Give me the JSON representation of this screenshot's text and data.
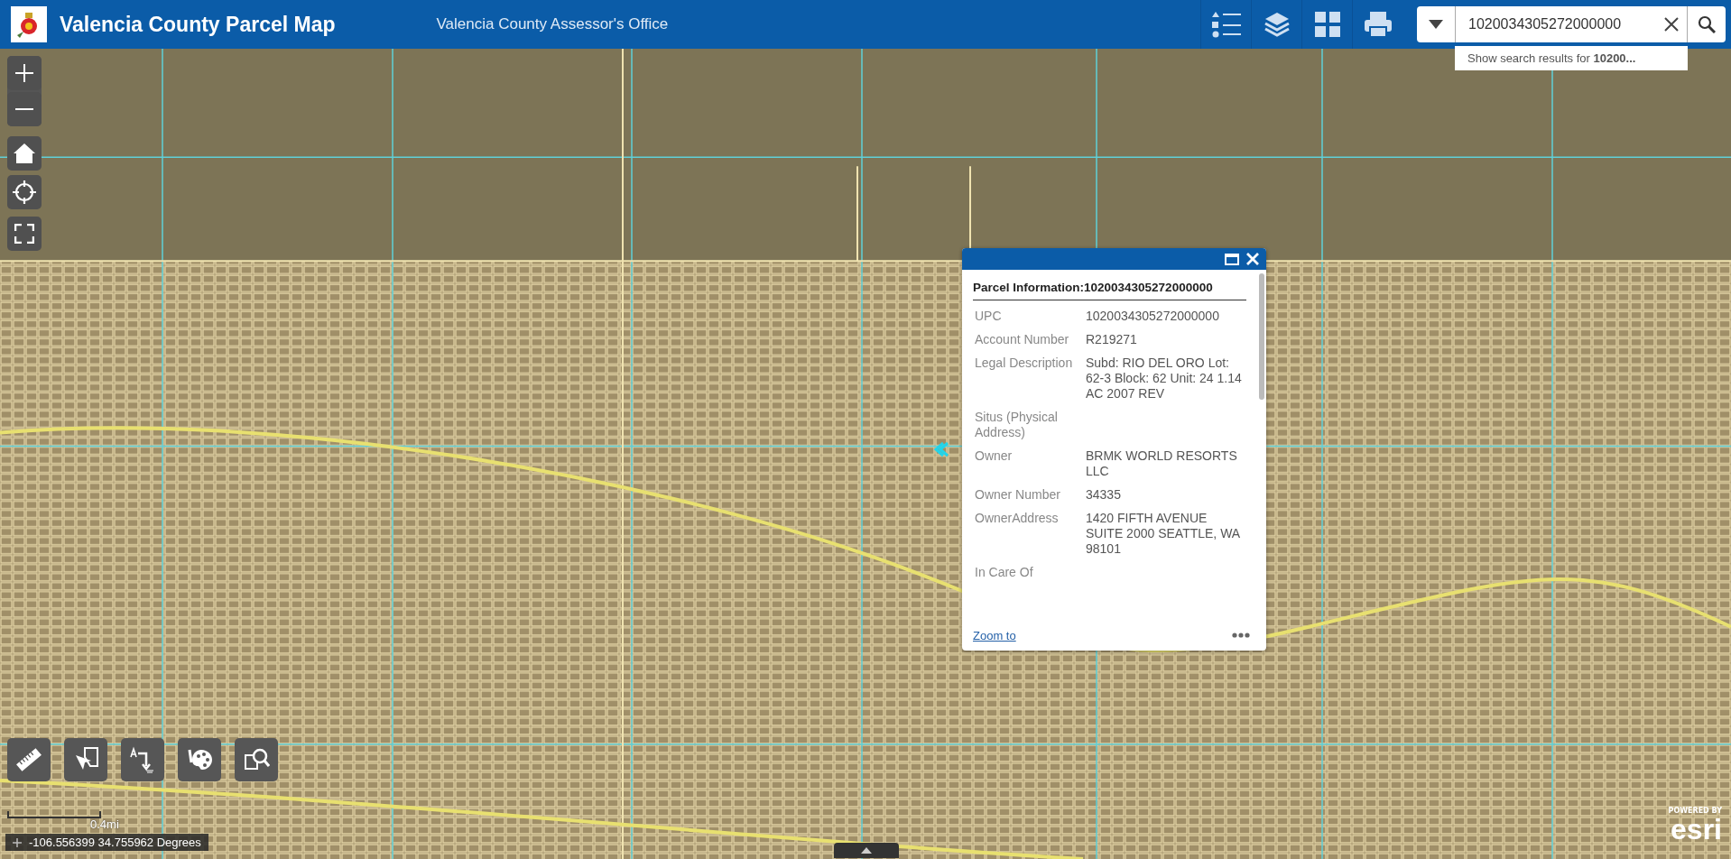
{
  "header": {
    "title": "Valencia County Parcel Map",
    "subtitle": "Valencia County Assessor's Office"
  },
  "search": {
    "value": "1020034305272000000",
    "suggestion": "Show search results for **10200...**"
  },
  "popup": {
    "title": "Parcel Information:1020034305272000000",
    "fields": [
      {
        "label": "UPC",
        "value": "1020034305272000000"
      },
      {
        "label": "Account Number",
        "value": "R219271"
      },
      {
        "label": "Legal Description",
        "value": "Subd: RIO DEL ORO Lot: 62-3 Block: 62 Unit: 24 1.14 AC 2007 REV"
      },
      {
        "label": "Situs (Physical Address)"
      },
      {
        "label": "Owner",
        "value": "BRMK WORLD RESORTS LLC"
      },
      {
        "label": "Owner Number",
        "value": "34335"
      },
      {
        "label": "OwnerAddress",
        "value": "1420 FIFTH AVENUE SUITE 2000 SEATTLE, WA 98101"
      },
      {
        "label": "In Care Of"
      }
    ],
    "link": "Zoom to"
  },
  "scale_bar": "0.4mi",
  "coordinates": "-106.556399 34.755962 Degrees",
  "attribution": {
    "powered": "POWERED BY",
    "logo": "esri"
  }
}
